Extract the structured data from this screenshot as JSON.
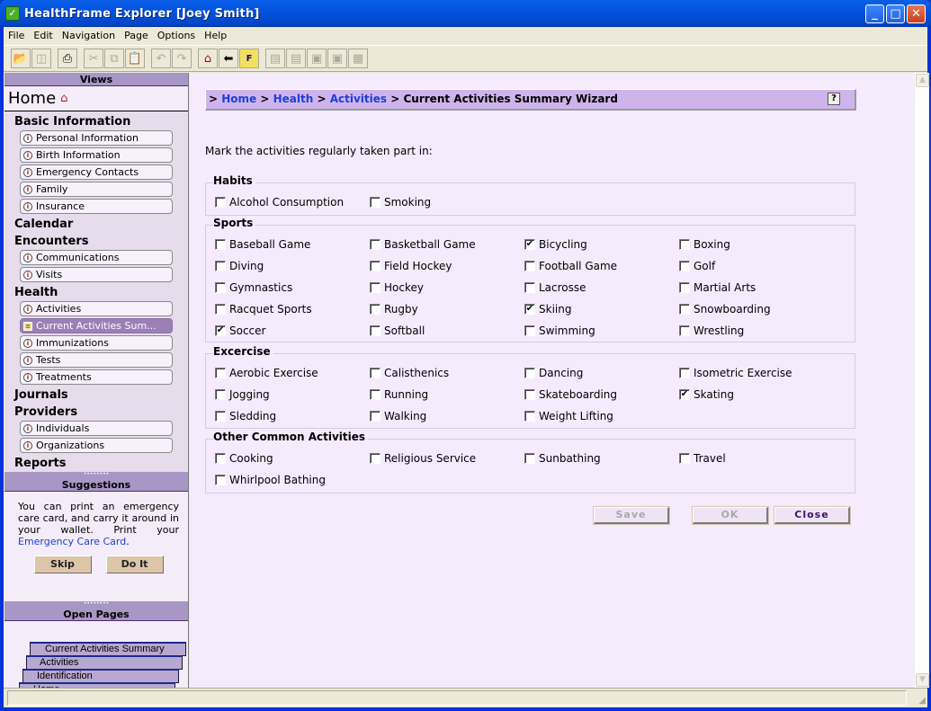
{
  "window": {
    "title": "HealthFrame Explorer [Joey Smith]",
    "buttons": [
      "minimize",
      "maximize",
      "close"
    ]
  },
  "menu": [
    "File",
    "Edit",
    "Navigation",
    "Page",
    "Options",
    "Help"
  ],
  "toolbar": [
    {
      "icon": "open-folder-icon",
      "enabled": true
    },
    {
      "icon": "copy-window-icon",
      "enabled": false
    },
    {
      "icon": "print-icon",
      "enabled": true
    },
    {
      "icon": "cut-icon",
      "enabled": false
    },
    {
      "icon": "copy-icon",
      "enabled": false
    },
    {
      "icon": "paste-icon",
      "enabled": false
    },
    {
      "icon": "undo-icon",
      "enabled": false
    },
    {
      "icon": "redo-icon",
      "enabled": false
    },
    {
      "icon": "home-icon",
      "enabled": true
    },
    {
      "icon": "back-arrow-icon",
      "enabled": true
    },
    {
      "icon": "file-folder-icon",
      "enabled": true
    },
    {
      "icon": "list-down-icon",
      "enabled": false
    },
    {
      "icon": "list-up-icon",
      "enabled": false
    },
    {
      "icon": "save-disk-icon",
      "enabled": false
    },
    {
      "icon": "save-down-icon",
      "enabled": false
    },
    {
      "icon": "layout-icon",
      "enabled": false
    }
  ],
  "sidebar": {
    "views_header": "Views",
    "home_label": "Home",
    "groups": [
      {
        "label": "Basic Information",
        "items": [
          "Personal Information",
          "Birth Information",
          "Emergency Contacts",
          "Family",
          "Insurance"
        ]
      },
      {
        "label": "Calendar",
        "items": []
      },
      {
        "label": "Encounters",
        "items": [
          "Communications",
          "Visits"
        ]
      },
      {
        "label": "Health",
        "items": [
          "Activities",
          "Current Activities Sum...",
          "Immunizations",
          "Tests",
          "Treatments"
        ],
        "active_index": 1
      },
      {
        "label": "Journals",
        "items": []
      },
      {
        "label": "Providers",
        "items": [
          "Individuals",
          "Organizations"
        ]
      },
      {
        "label": "Reports",
        "items": []
      }
    ],
    "suggestions_header": "Suggestions",
    "suggestion_text": "You can print an emergency care card, and carry it around in your wallet. Print your ",
    "suggestion_link": "Emergency Care Card",
    "suggestion_end": ".",
    "skip_label": "Skip",
    "doit_label": "Do It",
    "open_pages_header": "Open Pages",
    "open_pages": [
      "Current Activities Summary Wiz...",
      "Activities",
      "Identification",
      "Home"
    ]
  },
  "breadcrumb": {
    "prefix": ">",
    "links": [
      "Home",
      "Health",
      "Activities"
    ],
    "current": "Current Activities Summary Wizard",
    "separator": ">"
  },
  "form": {
    "instruction": "Mark the activities regularly taken part in:",
    "groups": [
      {
        "label": "Habits",
        "items": [
          {
            "label": "Alcohol Consumption",
            "checked": false
          },
          {
            "label": "Smoking",
            "checked": false
          }
        ]
      },
      {
        "label": "Sports",
        "items": [
          {
            "label": "Baseball Game",
            "checked": false
          },
          {
            "label": "Basketball Game",
            "checked": false
          },
          {
            "label": "Bicycling",
            "checked": true
          },
          {
            "label": "Boxing",
            "checked": false
          },
          {
            "label": "Diving",
            "checked": false
          },
          {
            "label": "Field Hockey",
            "checked": false
          },
          {
            "label": "Football Game",
            "checked": false
          },
          {
            "label": "Golf",
            "checked": false
          },
          {
            "label": "Gymnastics",
            "checked": false
          },
          {
            "label": "Hockey",
            "checked": false
          },
          {
            "label": "Lacrosse",
            "checked": false
          },
          {
            "label": "Martial Arts",
            "checked": false
          },
          {
            "label": "Racquet Sports",
            "checked": false
          },
          {
            "label": "Rugby",
            "checked": false
          },
          {
            "label": "Skiing",
            "checked": true
          },
          {
            "label": "Snowboarding",
            "checked": false
          },
          {
            "label": "Soccer",
            "checked": true
          },
          {
            "label": "Softball",
            "checked": false
          },
          {
            "label": "Swimming",
            "checked": false
          },
          {
            "label": "Wrestling",
            "checked": false
          }
        ]
      },
      {
        "label": "Excercise",
        "items": [
          {
            "label": "Aerobic Exercise",
            "checked": false
          },
          {
            "label": "Calisthenics",
            "checked": false
          },
          {
            "label": "Dancing",
            "checked": false
          },
          {
            "label": "Isometric Exercise",
            "checked": false
          },
          {
            "label": "Jogging",
            "checked": false
          },
          {
            "label": "Running",
            "checked": false
          },
          {
            "label": "Skateboarding",
            "checked": false
          },
          {
            "label": "Skating",
            "checked": true
          },
          {
            "label": "Sledding",
            "checked": false
          },
          {
            "label": "Walking",
            "checked": false
          },
          {
            "label": "Weight Lifting",
            "checked": false
          }
        ]
      },
      {
        "label": "Other Common Activities",
        "items": [
          {
            "label": "Cooking",
            "checked": false
          },
          {
            "label": "Religious Service",
            "checked": false
          },
          {
            "label": "Sunbathing",
            "checked": false
          },
          {
            "label": "Travel",
            "checked": false
          },
          {
            "label": "Whirlpool Bathing",
            "checked": false
          }
        ]
      }
    ],
    "buttons": [
      {
        "label": "Save",
        "enabled": false
      },
      {
        "label": "OK",
        "enabled": false
      },
      {
        "label": "Close",
        "enabled": true
      }
    ]
  }
}
